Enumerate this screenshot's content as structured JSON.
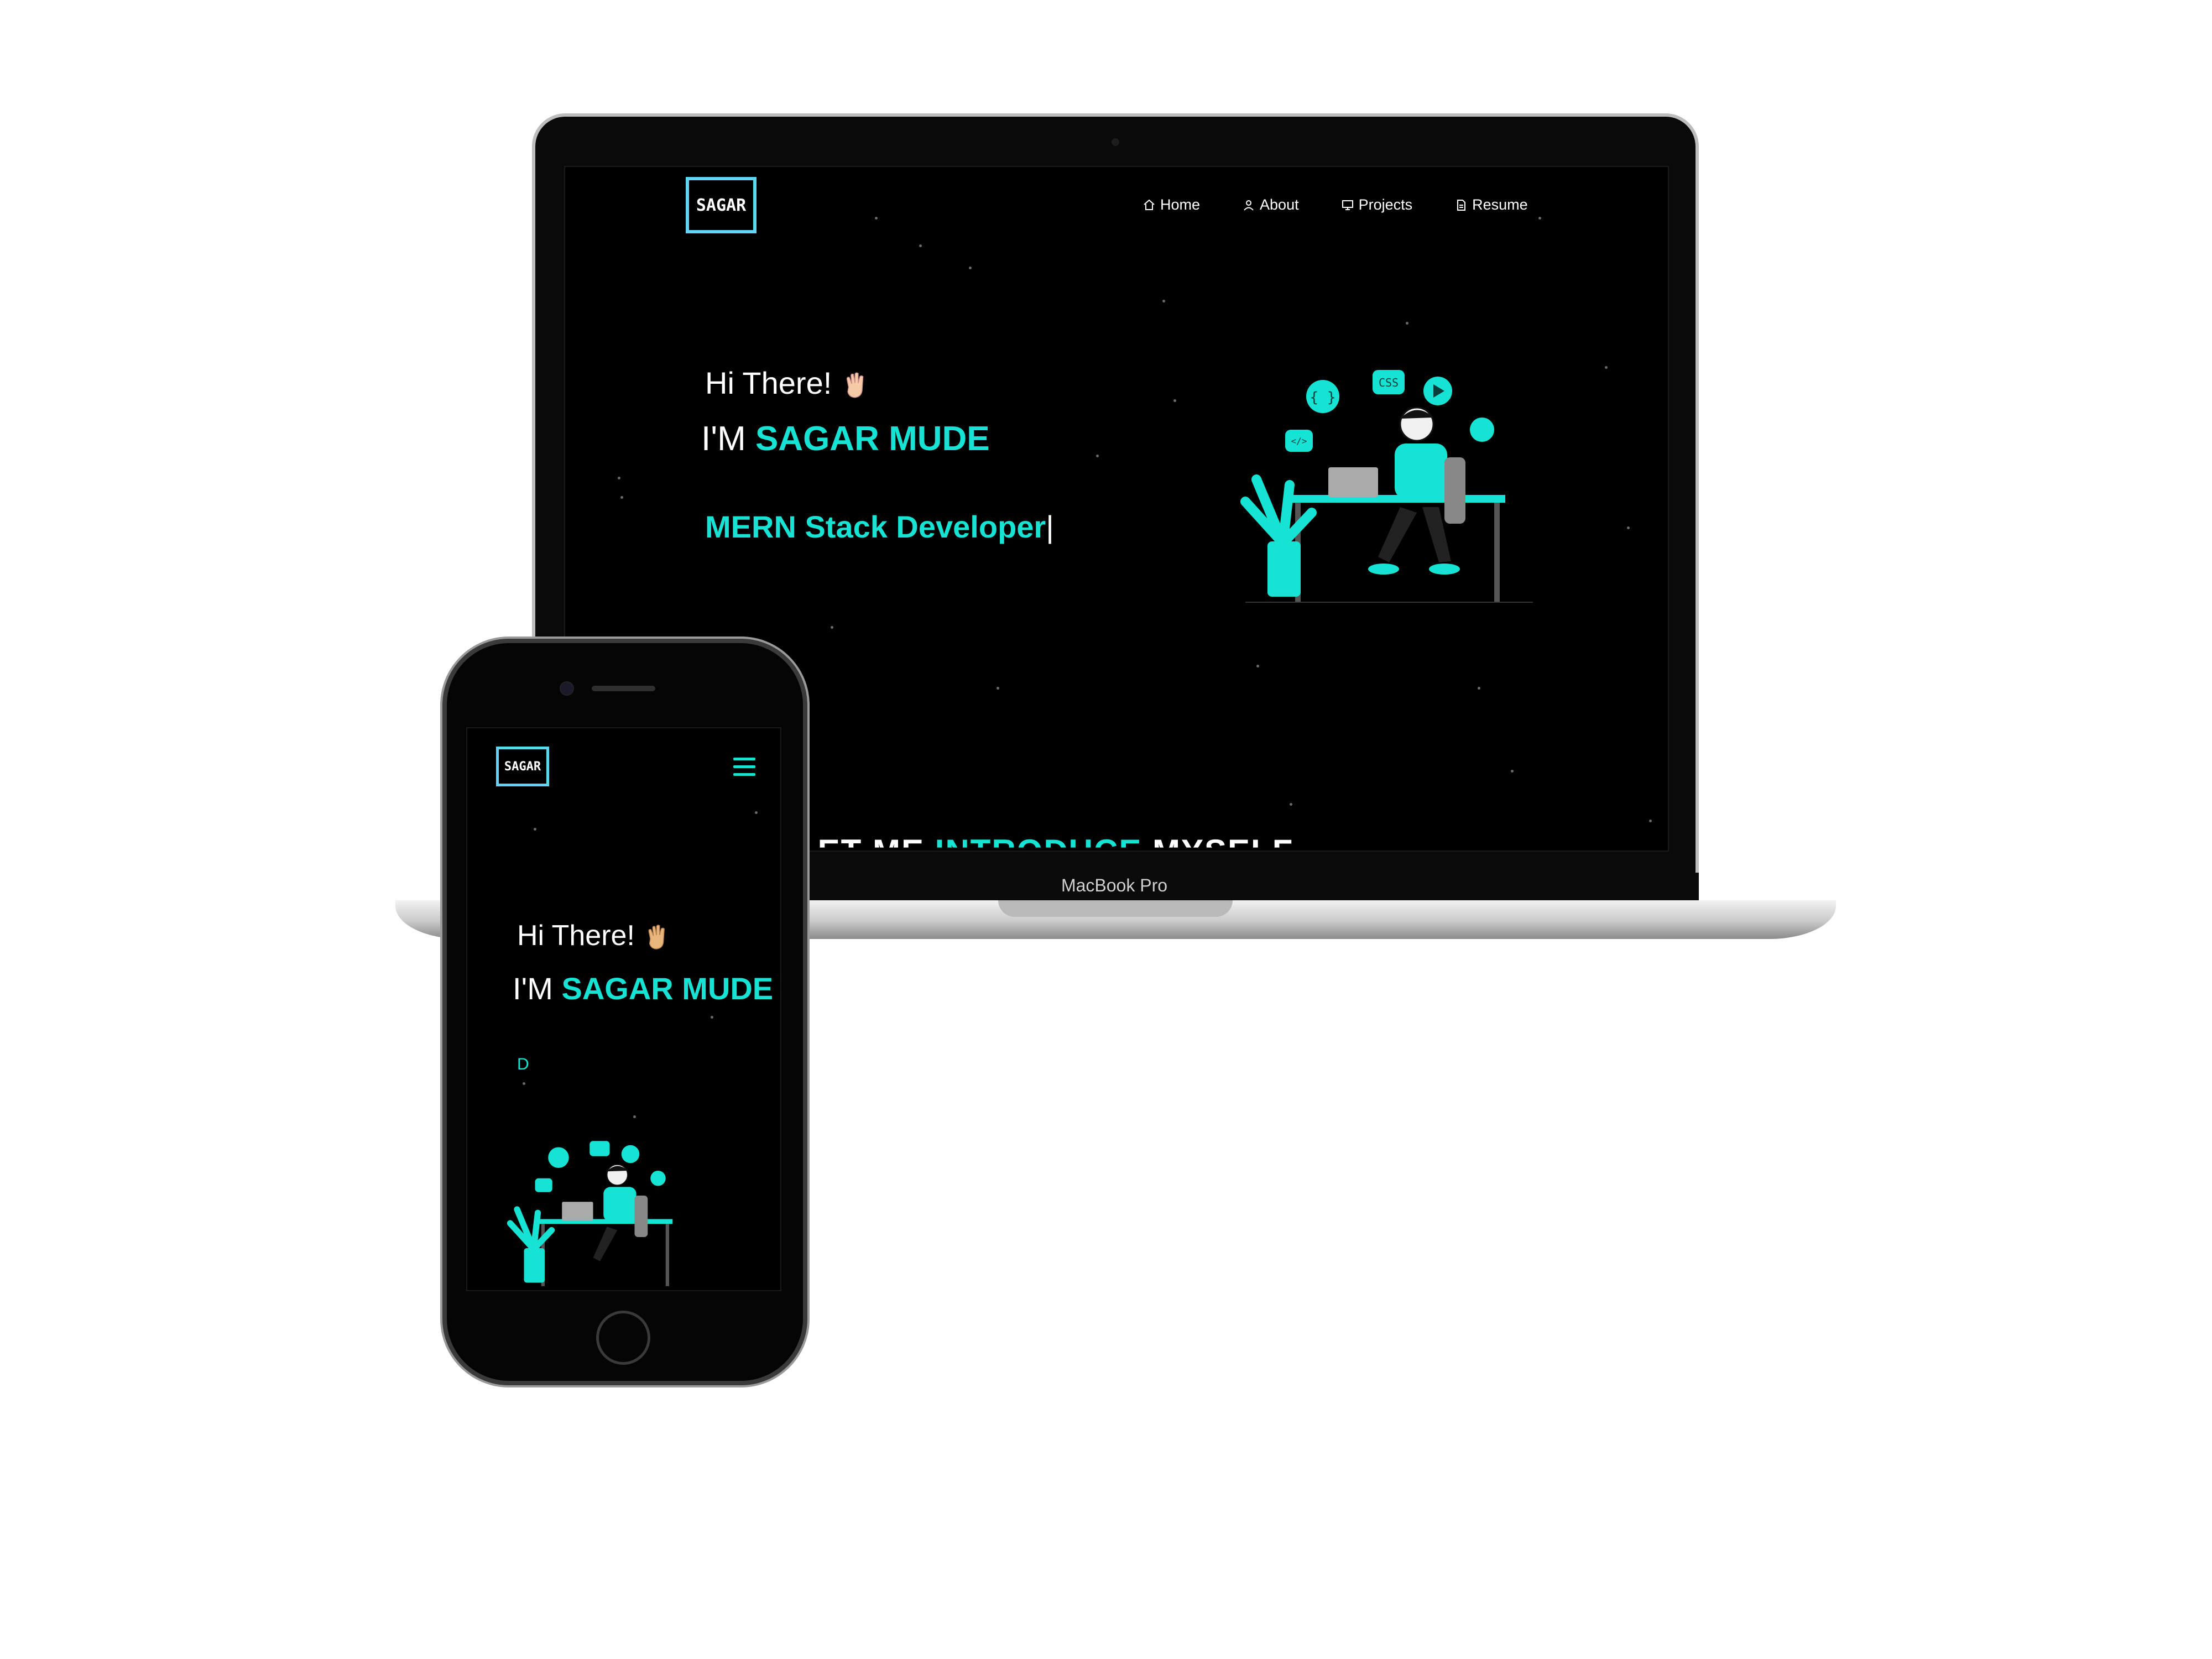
{
  "laptop": {
    "device_label": "MacBook Pro",
    "logo_text": "SAGAR",
    "nav": [
      {
        "label": "Home",
        "icon": "home-icon"
      },
      {
        "label": "About",
        "icon": "user-icon"
      },
      {
        "label": "Projects",
        "icon": "projects-icon"
      },
      {
        "label": "Resume",
        "icon": "document-icon"
      }
    ],
    "greeting": "Hi There!",
    "intro_prefix": "I'M",
    "name": "SAGAR MUDE",
    "role": "MERN Stack Developer",
    "cursor": "|",
    "section_heading": {
      "prefix": "LET ME",
      "highlight": "INTRODUCE",
      "suffix": "MYSELF"
    }
  },
  "phone": {
    "logo_text": "SAGAR",
    "menu_icon": "hamburger-icon",
    "greeting": "Hi There!",
    "intro_prefix": "I'M",
    "name": "SAGAR MUDE",
    "role_partial": "D"
  },
  "illustration_badges": [
    "{ }",
    "CSS",
    "</>"
  ],
  "colors": {
    "accent": "#16e3d3",
    "logo_border": "#5fd6ef",
    "background": "#000000"
  }
}
